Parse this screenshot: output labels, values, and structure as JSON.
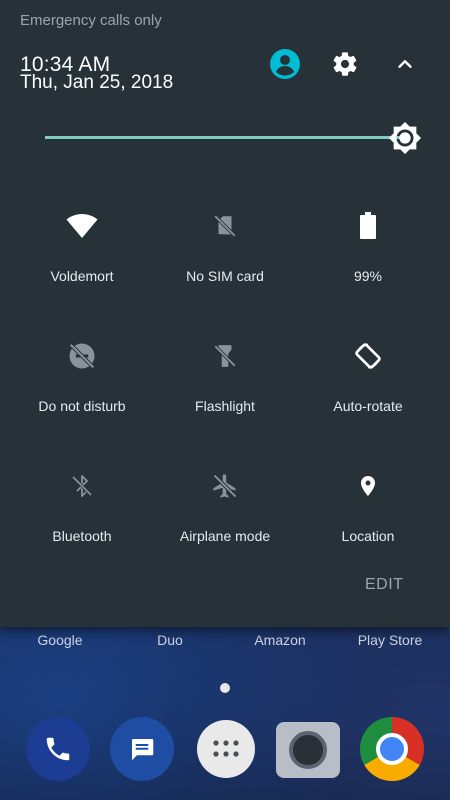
{
  "status_bar": {
    "carrier_text": "Emergency calls only"
  },
  "header": {
    "time": "10:34 AM",
    "date": "Thu, Jan 25, 2018",
    "icons": [
      "user-icon",
      "gear-icon",
      "chevron-up-icon"
    ]
  },
  "brightness": {
    "level": 0.97,
    "accent": "#80cbc4"
  },
  "tiles": [
    {
      "label": "Voldemort",
      "icon": "wifi-icon",
      "active": true
    },
    {
      "label": "No SIM card",
      "icon": "no-sim-icon",
      "active": false
    },
    {
      "label": "99%",
      "icon": "battery-icon",
      "active": true
    },
    {
      "label": "Do not disturb",
      "icon": "do-not-disturb-icon",
      "active": false
    },
    {
      "label": "Flashlight",
      "icon": "flashlight-icon",
      "active": false
    },
    {
      "label": "Auto-rotate",
      "icon": "auto-rotate-icon",
      "active": true
    },
    {
      "label": "Bluetooth",
      "icon": "bluetooth-icon",
      "active": false
    },
    {
      "label": "Airplane mode",
      "icon": "airplane-icon",
      "active": false
    },
    {
      "label": "Location",
      "icon": "location-icon",
      "active": true
    }
  ],
  "footer": {
    "edit_label": "EDIT"
  },
  "home": {
    "app_labels": [
      "Google",
      "Duo",
      "Amazon",
      "Play Store"
    ],
    "dock": [
      "phone-icon",
      "messages-icon",
      "app-drawer-icon",
      "camera-icon",
      "chrome-icon"
    ]
  },
  "colors": {
    "shade": "#263238",
    "accent": "#80cbc4",
    "user_icon": "#00bcd4"
  }
}
